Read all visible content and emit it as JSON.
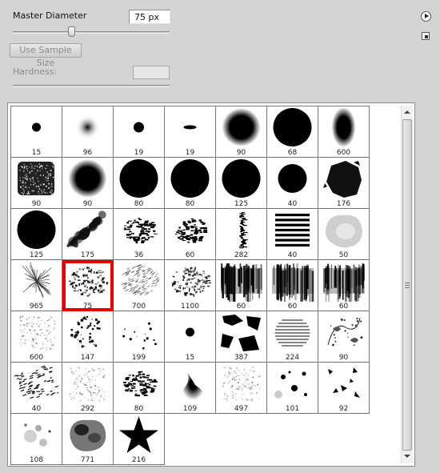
{
  "settings": {
    "master_diameter_label": "Master Diameter",
    "diameter_value": "75 px",
    "use_sample_size_label": "Use Sample Size",
    "hardness_label": "Hardness:",
    "slider_level_fraction": 0.38
  },
  "panel_menu_icon": "flyout-menu-icon",
  "new_preset_icon": "new-preset-icon",
  "accent_colors": {
    "selection_border": "#e80000",
    "panel_bg": "#d4d4d4"
  },
  "brushes": [
    {
      "size": "15",
      "shape": "hard-dot"
    },
    {
      "size": "96",
      "shape": "soft-dot"
    },
    {
      "size": "19",
      "shape": "hard-dot-small"
    },
    {
      "size": "19",
      "shape": "flat-ellipse"
    },
    {
      "size": "90",
      "shape": "soft-round"
    },
    {
      "size": "68",
      "shape": "hard-round"
    },
    {
      "size": "600",
      "shape": "vertical-ellipse"
    },
    {
      "size": "90",
      "shape": "textured-square"
    },
    {
      "size": "90",
      "shape": "soft-round"
    },
    {
      "size": "80",
      "shape": "hard-round"
    },
    {
      "size": "80",
      "shape": "hard-round"
    },
    {
      "size": "125",
      "shape": "hard-round"
    },
    {
      "size": "40",
      "shape": "hard-round-small"
    },
    {
      "size": "176",
      "shape": "ink-splat"
    },
    {
      "size": "125",
      "shape": "hard-round"
    },
    {
      "size": "175",
      "shape": "diagonal-stroke"
    },
    {
      "size": "36",
      "shape": "scatter-dense"
    },
    {
      "size": "60",
      "shape": "scatter-dense"
    },
    {
      "size": "282",
      "shape": "vertical-scribble"
    },
    {
      "size": "40",
      "shape": "horizontal-lines"
    },
    {
      "size": "50",
      "shape": "grey-cloud"
    },
    {
      "size": "965",
      "shape": "starburst"
    },
    {
      "size": "75",
      "shape": "scatter-splatter"
    },
    {
      "size": "700",
      "shape": "grass-texture"
    },
    {
      "size": "1100",
      "shape": "scatter-splatter"
    },
    {
      "size": "60",
      "shape": "grunge-streaks"
    },
    {
      "size": "60",
      "shape": "grunge-streaks"
    },
    {
      "size": "60",
      "shape": "grunge-streaks"
    },
    {
      "size": "600",
      "shape": "faint-texture"
    },
    {
      "size": "147",
      "shape": "sparse-splatter"
    },
    {
      "size": "199",
      "shape": "sparse-dots"
    },
    {
      "size": "15",
      "shape": "hard-dot"
    },
    {
      "size": "387",
      "shape": "torn-paper"
    },
    {
      "size": "224",
      "shape": "striped-ball"
    },
    {
      "size": "90",
      "shape": "floral-swirl"
    },
    {
      "size": "40",
      "shape": "dash-texture"
    },
    {
      "size": "292",
      "shape": "faint-texture"
    },
    {
      "size": "80",
      "shape": "scatter-dense"
    },
    {
      "size": "109",
      "shape": "smoke-blob"
    },
    {
      "size": "497",
      "shape": "faint-texture"
    },
    {
      "size": "101",
      "shape": "bubble-dots"
    },
    {
      "size": "92",
      "shape": "leaf-scatter"
    },
    {
      "size": "108",
      "shape": "grey-bubbles"
    },
    {
      "size": "771",
      "shape": "grey-cloud-dark"
    },
    {
      "size": "216",
      "shape": "star"
    }
  ],
  "selected_index": 22
}
